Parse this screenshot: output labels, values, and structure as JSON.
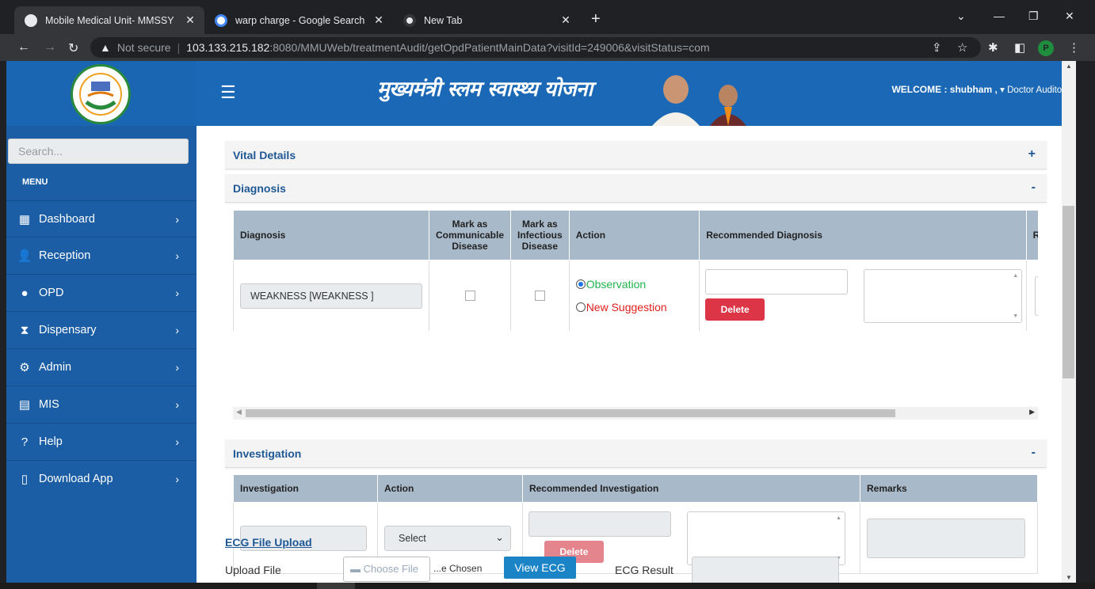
{
  "browser": {
    "tabs": [
      {
        "title": "Mobile Medical Unit- MMSSY",
        "active": true
      },
      {
        "title": "warp charge - Google Search",
        "active": false
      },
      {
        "title": "New Tab",
        "active": false
      }
    ],
    "security": "Not secure",
    "url_host": "103.133.215.182",
    "url_rest": ":8080/MMUWeb/treatmentAudit/getOpdPatientMainData?visitId=249006&visitStatus=com",
    "profile_initial": "P"
  },
  "header": {
    "brand": "मुख्यमंत्री स्लम स्वास्थ्य योजना",
    "welcome_prefix": "WELCOME :",
    "user": "shubham ,",
    "role": "Doctor Auditor"
  },
  "sidebar": {
    "search_placeholder": "Search...",
    "menu_title": "MENU",
    "items": [
      {
        "label": "Dashboard",
        "icon": "building-icon"
      },
      {
        "label": "Reception",
        "icon": "user-plus-icon"
      },
      {
        "label": "OPD",
        "icon": "user-doctor-icon"
      },
      {
        "label": "Dispensary",
        "icon": "hourglass-icon"
      },
      {
        "label": "Admin",
        "icon": "user-gear-icon"
      },
      {
        "label": "MIS",
        "icon": "file-plus-icon"
      },
      {
        "label": "Help",
        "icon": "question-circle-icon"
      },
      {
        "label": "Download App",
        "icon": "mobile-icon"
      }
    ]
  },
  "vital": {
    "title": "Vital Details",
    "toggle": "+"
  },
  "diagnosis": {
    "title": "Diagnosis",
    "toggle": "-",
    "headers": {
      "diagnosis": "Diagnosis",
      "communicable": "Mark as Communicable Disease",
      "infectious": "Mark as Infectious Disease",
      "action": "Action",
      "recommended": "Recommended Diagnosis",
      "cut": "R"
    },
    "row": {
      "value": "WEAKNESS [WEAKNESS ]",
      "option_observation": "Observation",
      "option_suggestion": "New Suggestion",
      "delete_label": "Delete"
    }
  },
  "investigation": {
    "title": "Investigation",
    "toggle": "-",
    "headers": {
      "investigation": "Investigation",
      "action": "Action",
      "recommended": "Recommended Investigation",
      "remarks": "Remarks"
    },
    "row": {
      "select_value": "Select",
      "delete_label": "Delete"
    }
  },
  "ecg": {
    "title": "ECG File Upload",
    "upload_label": "Upload File",
    "choose_label": "Choose File",
    "chosen_text": "...e Chosen",
    "view_label": "View ECG",
    "result_label": "ECG Result"
  },
  "colors": {
    "sidebar": "#1b5ea6",
    "header": "#1a68b6",
    "table_header": "#a8b9c9",
    "delete": "#dc3545",
    "observation": "#22b34a",
    "suggestion": "#e0201b"
  }
}
